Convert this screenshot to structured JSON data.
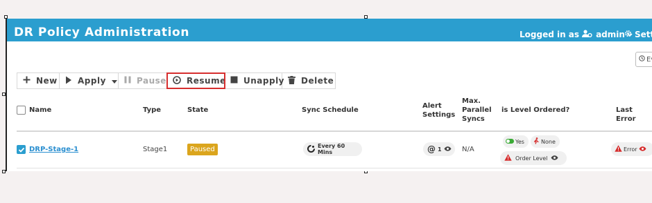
{
  "header": {
    "title": "DR Policy Administration",
    "logged_in_label": "Logged in as",
    "username": "admin",
    "settings_label": "Setti"
  },
  "events_button_label": "Ev",
  "toolbar": {
    "new_label": "New",
    "apply_label": "Apply",
    "pause_label": "Pause",
    "resume_label": "Resume",
    "unapply_label": "Unapply",
    "delete_label": "Delete"
  },
  "table": {
    "columns": {
      "name": "Name",
      "type": "Type",
      "state": "State",
      "sync_schedule": "Sync Schedule",
      "alert_line1": "Alert",
      "alert_line2": "Settings",
      "max_line1": "Max.",
      "max_line2": "Parallel",
      "max_line3": "Syncs",
      "level_ordered": "is Level Ordered?",
      "last_error": "Last Error"
    },
    "rows": [
      {
        "name": "DRP-Stage-1",
        "type": "Stage1",
        "state": "Paused",
        "sync_schedule": "Every 60 Mins",
        "alert_count": "1",
        "max_parallel_syncs": "N/A",
        "level_yes": "Yes",
        "level_none": "None",
        "order_level": "Order Level",
        "last_error": "Error"
      }
    ]
  },
  "colors": {
    "header_bg": "#2b9ecf",
    "paused_badge": "#dba51d",
    "error_red": "#d62d2d",
    "toggle_green": "#3aaa35"
  }
}
